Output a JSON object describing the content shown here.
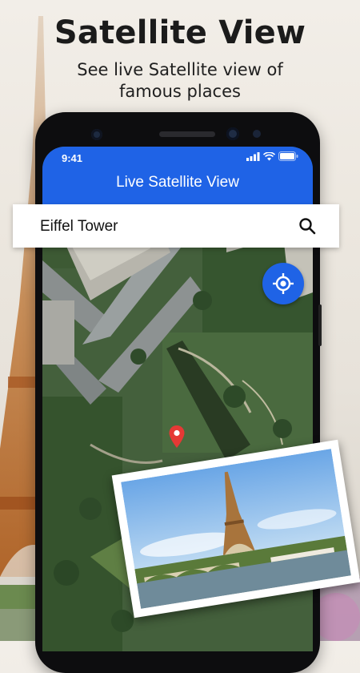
{
  "promo": {
    "headline": "Satellite View",
    "subline": "See live Satellite view of famous places"
  },
  "status_bar": {
    "time": "9:41",
    "icons": [
      "signal-icon",
      "wifi-icon",
      "battery-icon"
    ]
  },
  "app_bar": {
    "title": "Live Satellite View"
  },
  "search": {
    "value": "Eiffel Tower",
    "icon": "search-icon"
  },
  "map": {
    "locate_icon": "my-location-icon",
    "marker_icon": "location-pin-icon"
  },
  "colors": {
    "accent": "#1f63e6",
    "pin": "#e53935"
  }
}
